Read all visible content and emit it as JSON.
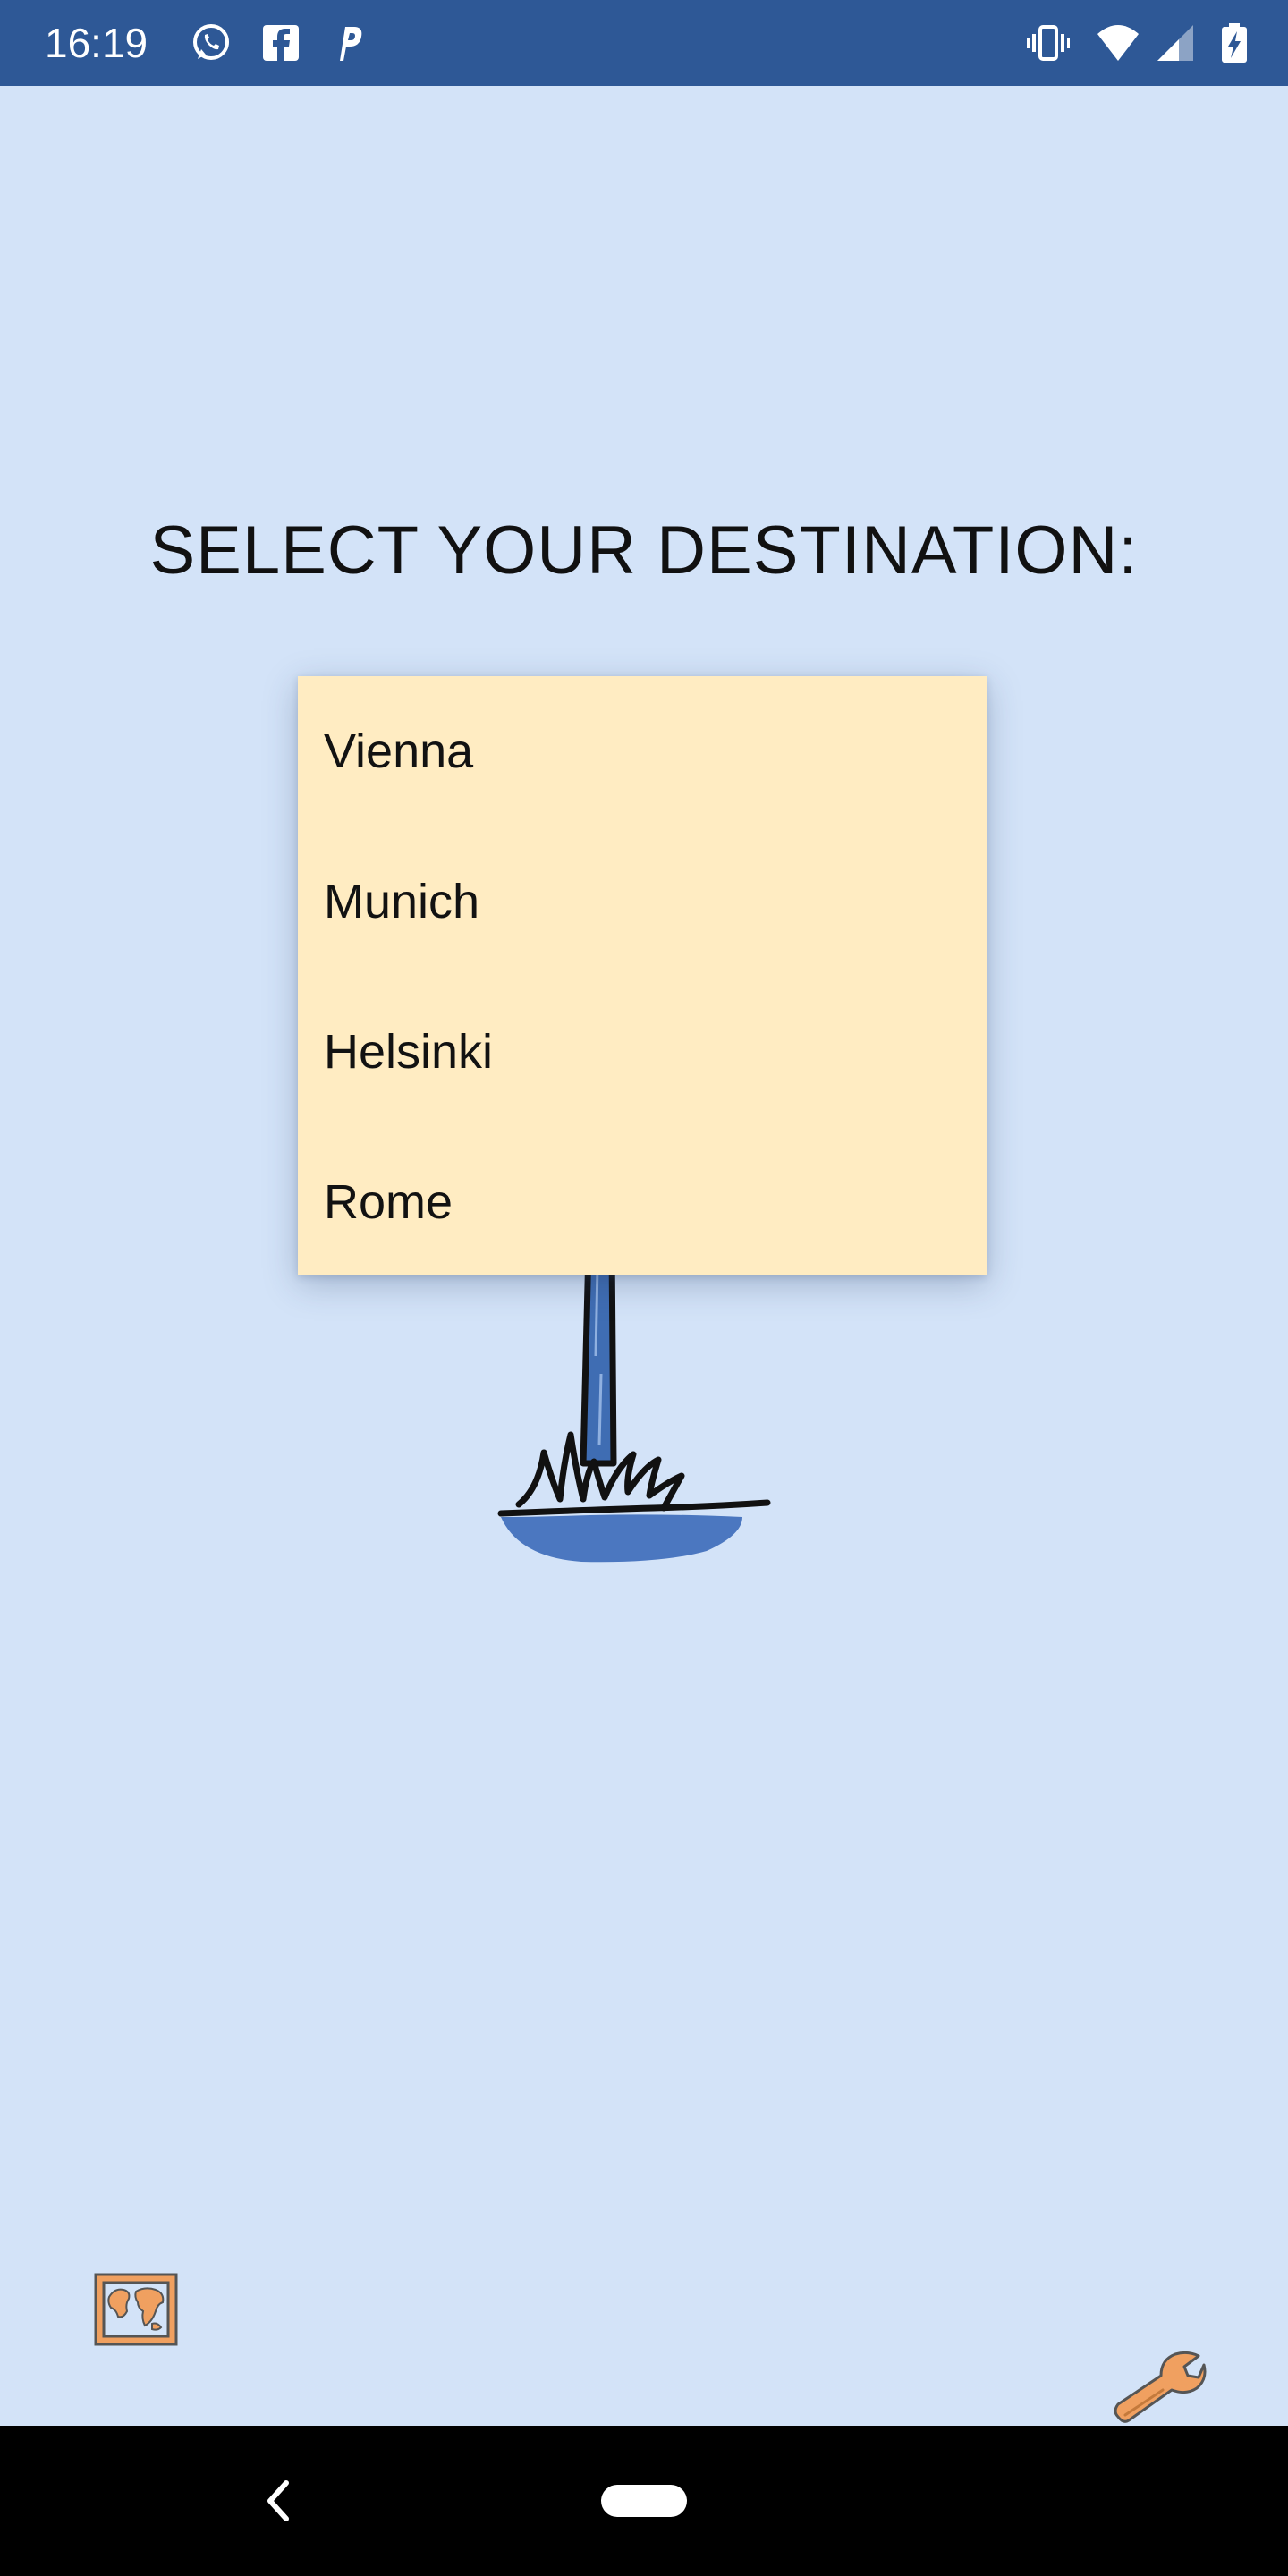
{
  "status_bar": {
    "time": "16:19",
    "notification_icons": [
      "whatsapp-icon",
      "facebook-icon",
      "parking-icon"
    ],
    "system_icons": [
      "vibrate-icon",
      "wifi-icon",
      "cell-signal-icon",
      "battery-charging-icon"
    ],
    "background_color": "#2e5896"
  },
  "screen": {
    "background_color": "#d3e3f8",
    "title": "SELECT YOUR DESTINATION:"
  },
  "dropdown": {
    "background_color": "#ffecc2",
    "options": [
      {
        "label": "Vienna"
      },
      {
        "label": "Munich"
      },
      {
        "label": "Helsinki"
      },
      {
        "label": "Rome"
      }
    ]
  },
  "signpost": {
    "icon": "signpost-icon",
    "pole_color": "#3f6db3",
    "ground_color": "#4b77c0"
  },
  "bottom_actions": {
    "map_icon": "world-map-icon",
    "settings_icon": "wrench-icon",
    "accent_color": "#f0a060"
  },
  "nav_bar": {
    "back_icon": "back-chevron-icon",
    "home_icon": "home-pill-icon"
  }
}
